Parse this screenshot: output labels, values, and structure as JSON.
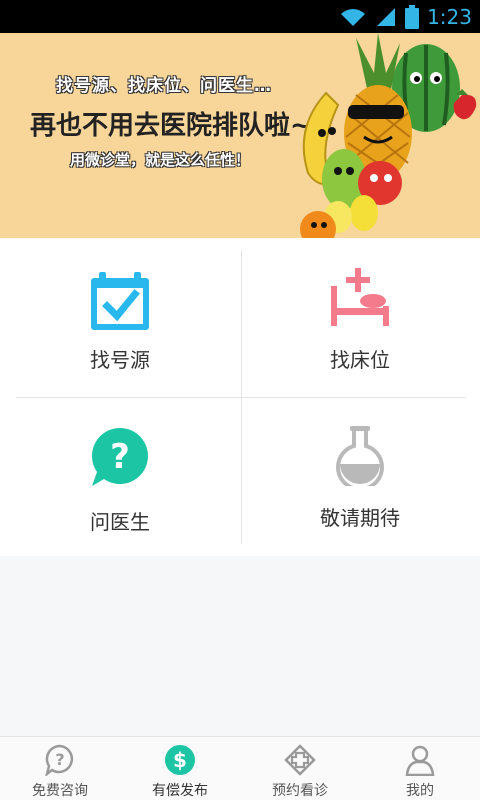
{
  "status_bar": {
    "time": "1:23"
  },
  "banner": {
    "line1": "找号源、找床位、问医生…",
    "line2": "再也不用去医院排队啦~",
    "line3": "用微诊堂，就是这么任性！"
  },
  "grid": {
    "find_source": "找号源",
    "find_bed": "找床位",
    "ask_doctor": "问医生",
    "coming_soon": "敬请期待"
  },
  "bottom_nav": {
    "items": [
      {
        "label": "免费咨询",
        "icon": "question-icon",
        "active": false
      },
      {
        "label": "有偿发布",
        "icon": "dollar-icon",
        "active": true
      },
      {
        "label": "预约看诊",
        "icon": "medical-cross-icon",
        "active": false
      },
      {
        "label": "我的",
        "icon": "person-icon",
        "active": false
      }
    ]
  },
  "colors": {
    "accent_teal": "#1cc6a5",
    "calendar_blue": "#29b8ee",
    "bed_pink": "#f47b8b",
    "flask_gray": "#b9b9b9",
    "banner_bg": "#f8d69a",
    "time_blue": "#33b5e5"
  }
}
